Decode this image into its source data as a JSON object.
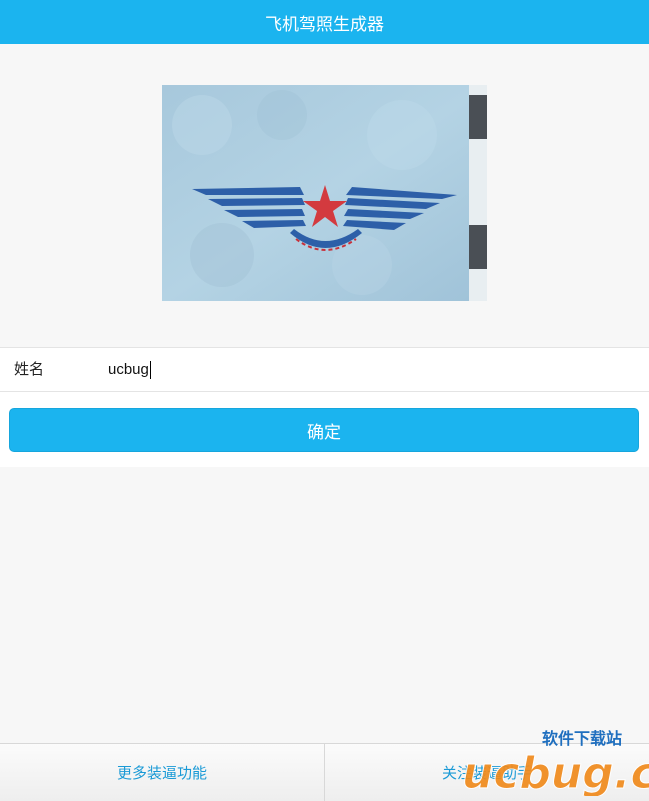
{
  "header": {
    "title": "飞机驾照生成器"
  },
  "hero": {
    "image": "aviation-wings-emblem"
  },
  "form": {
    "name_label": "姓名",
    "name_value": "ucbug"
  },
  "actions": {
    "confirm_label": "确定"
  },
  "footer": {
    "tabs": [
      {
        "label": "更多装逼功能"
      },
      {
        "label": "关注装逼助手"
      }
    ]
  },
  "watermark": {
    "brand": "ucbug.cc",
    "subtitle": "软件下载站"
  },
  "colors": {
    "accent": "#1bb4ef",
    "link": "#1a9ad6"
  }
}
